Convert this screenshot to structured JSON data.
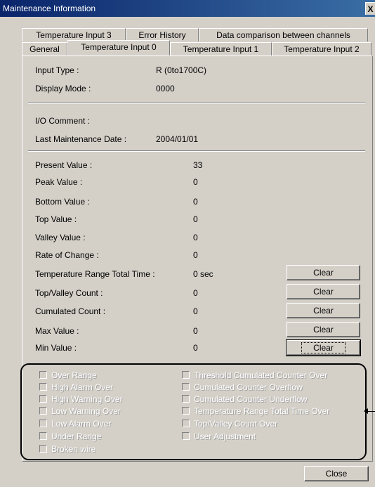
{
  "window": {
    "title": "Maintenance Information",
    "close_glyph": "X"
  },
  "tabs_back": [
    "Temperature Input 3",
    "Error History",
    "Data comparison between channels"
  ],
  "tabs_front": [
    "General",
    "Temperature Input 0",
    "Temperature Input 1",
    "Temperature Input 2"
  ],
  "active_tab": "Temperature Input 0",
  "info": {
    "input_type": {
      "label": "Input Type :",
      "value": "R (0to1700C)"
    },
    "display_mode": {
      "label": "Display Mode :",
      "value": "0000"
    },
    "io_comment": {
      "label": "I/O Comment :",
      "value": ""
    },
    "last_maintenance": {
      "label": "Last Maintenance Date :",
      "value": "2004/01/01"
    }
  },
  "values": {
    "present": {
      "label": "Present Value :",
      "value": "33"
    },
    "peak": {
      "label": "Peak Value :",
      "value": "0"
    },
    "bottom": {
      "label": "Bottom Value :",
      "value": "0"
    },
    "top": {
      "label": "Top Value :",
      "value": "0"
    },
    "valley": {
      "label": "Valley Value :",
      "value": "0"
    },
    "rate": {
      "label": "Rate of Change :",
      "value": "0"
    },
    "range_time": {
      "label": "Temperature Range Total Time :",
      "value": "0 sec"
    },
    "top_valley": {
      "label": "Top/Valley Count :",
      "value": "0"
    },
    "cumulated": {
      "label": "Cumulated Count :",
      "value": "0"
    },
    "max": {
      "label": "Max Value :",
      "value": "0"
    },
    "min": {
      "label": "Min Value :",
      "value": "0"
    }
  },
  "clear_label": "Clear",
  "status_left": [
    "Over Range",
    "High Alarm Over",
    "High Warning Over",
    "Low Warning Over",
    "Low Alarm Over",
    "Under Range",
    "Broken wire"
  ],
  "status_right": [
    "Threshold Cumulated Counter Over",
    "Cumulated Counter Overflow",
    "Cumulated Counter Underflow",
    "Temperature Range Total Time Over",
    "Top/Valley Count Over",
    "User Adjustment"
  ],
  "close_label": "Close"
}
